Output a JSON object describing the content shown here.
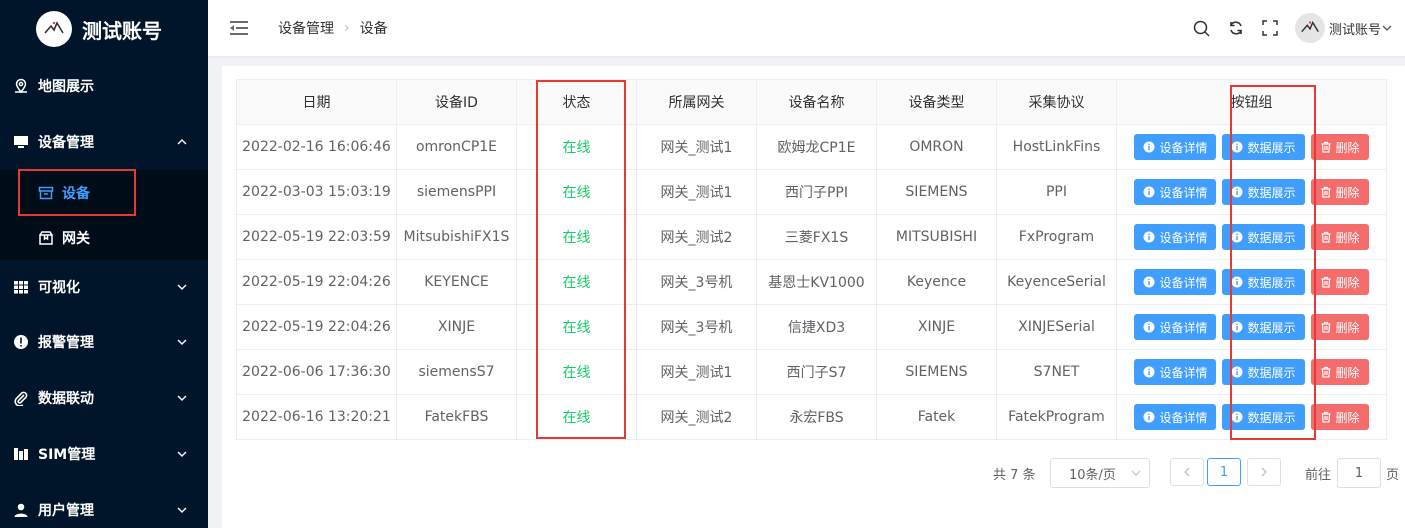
{
  "sidebar": {
    "brand": "测试账号",
    "items": [
      {
        "label": "地图展示"
      },
      {
        "label": "设备管理"
      },
      {
        "label": "可视化"
      },
      {
        "label": "报警管理"
      },
      {
        "label": "数据联动"
      },
      {
        "label": "SIM管理"
      },
      {
        "label": "用户管理"
      }
    ],
    "sub_items": [
      {
        "label": "设备"
      },
      {
        "label": "网关"
      }
    ],
    "active_color": "#409eff"
  },
  "header": {
    "breadcrumb": [
      "设备管理",
      "设备"
    ],
    "user": "测试账号"
  },
  "table": {
    "columns": [
      "日期",
      "设备ID",
      "状态",
      "所属网关",
      "设备名称",
      "设备类型",
      "采集协议",
      "按钮组"
    ],
    "rows": [
      {
        "date": "2022-02-16 16:06:46",
        "id": "omronCP1E",
        "status": "在线",
        "gateway": "网关_测试1",
        "name": "欧姆龙CP1E",
        "type": "OMRON",
        "protocol": "HostLinkFins"
      },
      {
        "date": "2022-03-03 15:03:19",
        "id": "siemensPPI",
        "status": "在线",
        "gateway": "网关_测试1",
        "name": "西门子PPI",
        "type": "SIEMENS",
        "protocol": "PPI"
      },
      {
        "date": "2022-05-19 22:03:59",
        "id": "MitsubishiFX1S",
        "status": "在线",
        "gateway": "网关_测试2",
        "name": "三菱FX1S",
        "type": "MITSUBISHI",
        "protocol": "FxProgram"
      },
      {
        "date": "2022-05-19 22:04:26",
        "id": "KEYENCE",
        "status": "在线",
        "gateway": "网关_3号机",
        "name": "基恩士KV1000",
        "type": "Keyence",
        "protocol": "KeyenceSerial"
      },
      {
        "date": "2022-05-19 22:04:26",
        "id": "XINJE",
        "status": "在线",
        "gateway": "网关_3号机",
        "name": "信捷XD3",
        "type": "XINJE",
        "protocol": "XINJESerial"
      },
      {
        "date": "2022-06-06 17:36:30",
        "id": "siemensS7",
        "status": "在线",
        "gateway": "网关_测试1",
        "name": "西门子S7",
        "type": "SIEMENS",
        "protocol": "S7NET"
      },
      {
        "date": "2022-06-16 13:20:21",
        "id": "FatekFBS",
        "status": "在线",
        "gateway": "网关_测试2",
        "name": "永宏FBS",
        "type": "Fatek",
        "protocol": "FatekProgram"
      }
    ],
    "buttons": {
      "detail": "设备详情",
      "data": "数据展示",
      "delete": "删除"
    },
    "status_color": "#13ce66"
  },
  "pagination": {
    "total": "共 7 条",
    "page_size": "10条/页",
    "current": "1",
    "goto_label": "前往",
    "goto_value": "1",
    "page_suffix": "页"
  }
}
